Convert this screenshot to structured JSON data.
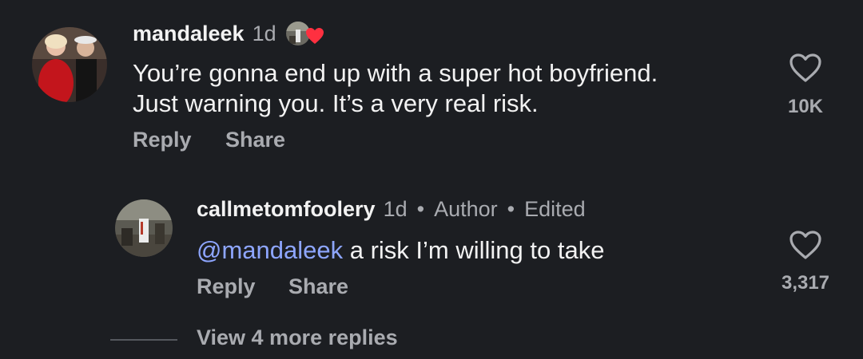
{
  "comments": [
    {
      "username": "mandaleek",
      "time": "1d",
      "text_lines": [
        "You’re gonna end up with a super hot boyfriend.",
        "Just warning you. It’s a very real risk."
      ],
      "actions": {
        "reply": "Reply",
        "share": "Share"
      },
      "likes": "10K"
    }
  ],
  "reply": {
    "username": "callmetomfoolery",
    "time": "1d",
    "author_label": "Author",
    "edited_label": "Edited",
    "mention": "@mandaleek",
    "text": " a risk I’m willing to take",
    "actions": {
      "reply": "Reply",
      "share": "Share"
    },
    "likes": "3,317"
  },
  "view_more": "View 4 more replies",
  "colors": {
    "background": "#1c1e22",
    "text": "#f2f2f2",
    "secondary": "#a9abb0",
    "mention": "#8ea6ff",
    "heart_badge": "#ff3040"
  },
  "icons": [
    "heart-icon",
    "liked-heart-badge-icon"
  ]
}
